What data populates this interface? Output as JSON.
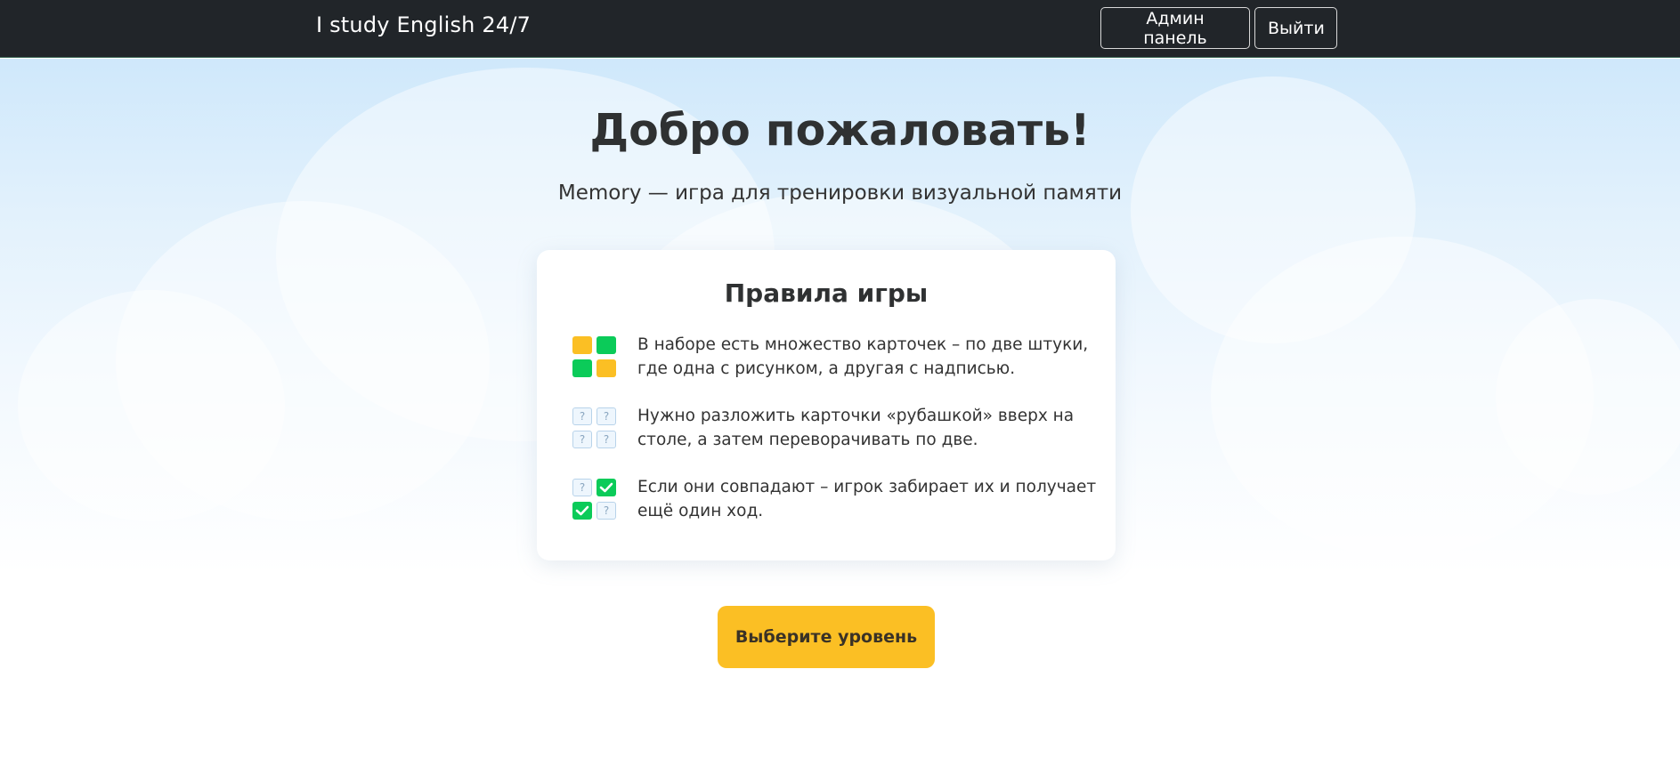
{
  "navbar": {
    "brand": "I study English 24/7",
    "admin_button": "Админ панель",
    "logout_button": "Выйти"
  },
  "hero": {
    "title": "Добро пожаловать!",
    "subtitle": "Memory — игра для тренировки визуальной памяти"
  },
  "rules": {
    "title": "Правила игры",
    "items": [
      {
        "icon": "color-cards-icon",
        "text": "В наборе есть множество карточек – по две штуки, где одна с рисунком, а другая с надписью."
      },
      {
        "icon": "face-down-cards-icon",
        "text": "Нужно разложить карточки «рубашкой» вверх на столе, а затем переворачивать по две."
      },
      {
        "icon": "matched-cards-icon",
        "text": "Если они совпадают – игрок забирает их и получает ещё один ход."
      }
    ]
  },
  "cta": {
    "label": "Выберите уровень"
  },
  "colors": {
    "navbar": "#212529",
    "accent_yellow": "#fbbf24",
    "accent_green": "#0bcb59",
    "sky": "#cfe8fb"
  }
}
